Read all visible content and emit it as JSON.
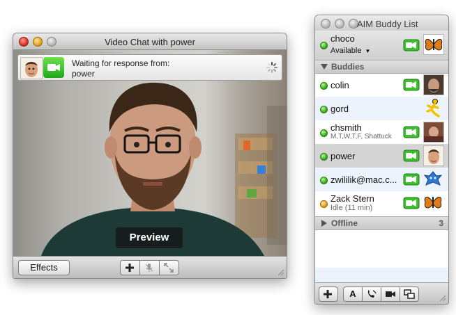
{
  "video_window": {
    "title": "Video Chat with power",
    "status": {
      "line1": "Waiting for response from:",
      "line2": "power"
    },
    "preview_label": "Preview",
    "toolbar": {
      "effects_label": "Effects"
    }
  },
  "buddy_window": {
    "title": "AIM Buddy List",
    "me": {
      "name": "choco",
      "status": "Available"
    },
    "groups": [
      {
        "label": "Buddies"
      },
      {
        "label": "Offline",
        "count": "3"
      }
    ],
    "buddies": [
      {
        "name": "colin",
        "status": "",
        "presence": "available",
        "video": true
      },
      {
        "name": "gord",
        "status": "",
        "presence": "available",
        "video": false
      },
      {
        "name": "chsmith",
        "status": "M,T,W,T,F, Shattuck",
        "presence": "available",
        "video": true
      },
      {
        "name": "power",
        "status": "",
        "presence": "available",
        "video": true
      },
      {
        "name": "zwililik@mac.c...",
        "status": "",
        "presence": "available",
        "video": true
      },
      {
        "name": "Zack Stern",
        "status": "Idle (11 min)",
        "presence": "idle",
        "video": true
      }
    ],
    "toolbar": {
      "font_label": "A"
    }
  },
  "colors": {
    "available": "#3fb21b",
    "idle": "#e9a420",
    "camera_green": "#2fb61e",
    "selection": "#d4d4d4",
    "alt_row": "#edf3fd"
  },
  "icons": [
    "close-icon",
    "minimize-icon",
    "zoom-icon",
    "camera-icon",
    "spinner-icon",
    "plus-icon",
    "mute-mic-icon",
    "fullscreen-icon",
    "resize-grip-icon",
    "butterfly-icon",
    "aim-running-man-icon",
    "phone-icon",
    "video-icon",
    "screen-share-icon",
    "chevron-down-icon",
    "disclosure-triangle-icon"
  ]
}
